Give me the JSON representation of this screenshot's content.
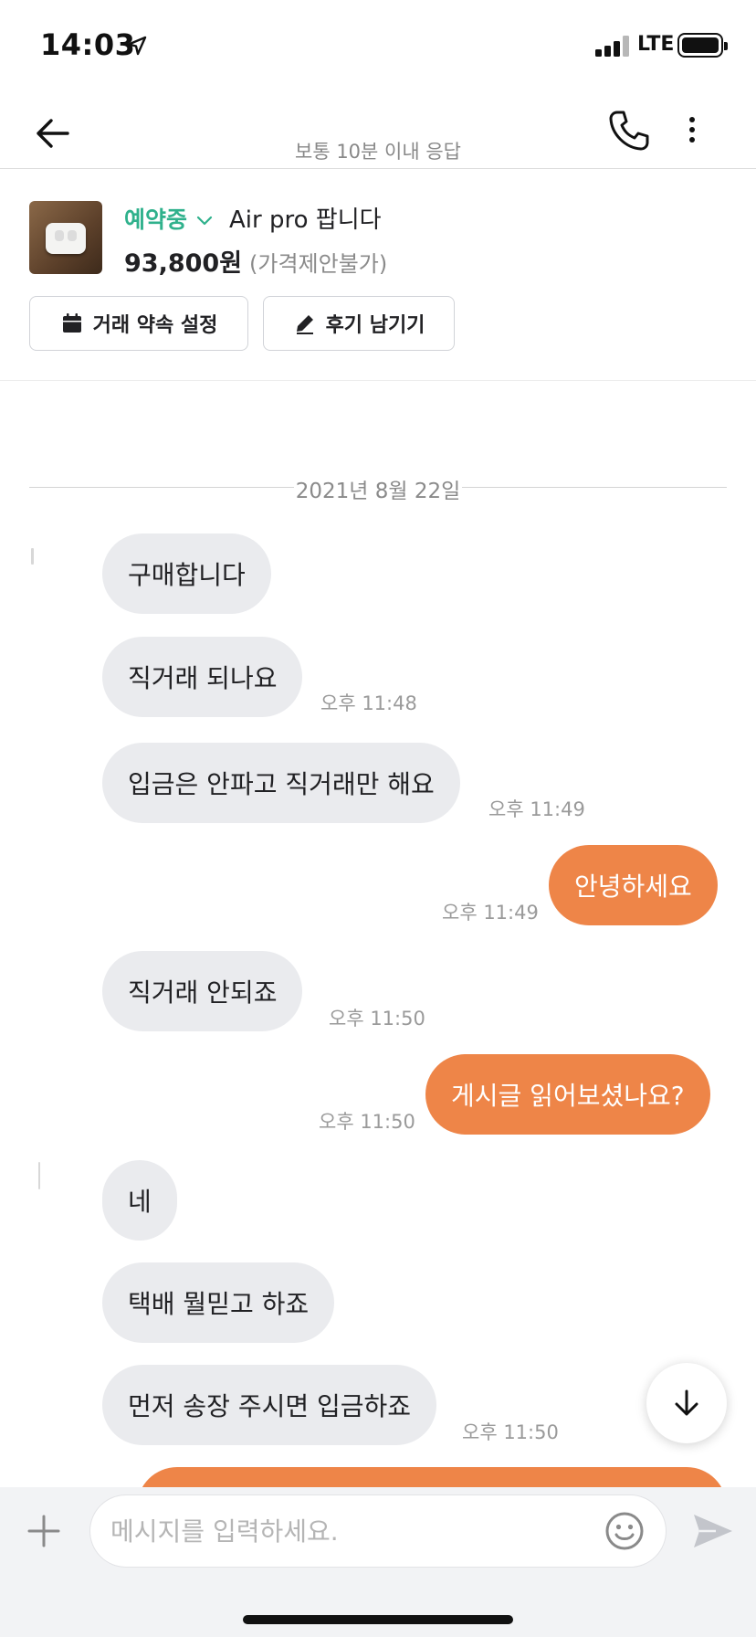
{
  "status_bar": {
    "time": "14:03",
    "network": "LTE"
  },
  "header": {
    "response_time": "보통 10분 이내 응답"
  },
  "product": {
    "status": "예약중",
    "title": "Air pro 팝니다",
    "price": "93,800원",
    "price_note": "(가격제안불가)",
    "buttons": {
      "schedule": "거래 약속 설정",
      "review": "후기 남기기"
    }
  },
  "chat": {
    "date": "2021년 8월 22일",
    "messages": [
      {
        "dir": "in",
        "text": "구매합니다",
        "time": ""
      },
      {
        "dir": "in",
        "text": "직거래 되나요",
        "time": "오후 11:48"
      },
      {
        "dir": "in",
        "text": "입금은 안파고 직거래만 해요",
        "time": "오후 11:49"
      },
      {
        "dir": "out",
        "text": "안녕하세요",
        "time": "오후 11:49"
      },
      {
        "dir": "in",
        "text": "직거래 안되죠",
        "time": "오후 11:50"
      },
      {
        "dir": "out",
        "text": "게시글 읽어보셨나요?",
        "time": "오후 11:50"
      },
      {
        "dir": "in",
        "text": "네",
        "time": ""
      },
      {
        "dir": "in",
        "text": "택배 뭘믿고 하죠",
        "time": ""
      },
      {
        "dir": "in",
        "text": "먼저 송장 주시면 입금하죠",
        "time": "오후 11:50"
      }
    ]
  },
  "composer": {
    "placeholder": "메시지를 입력하세요."
  },
  "colors": {
    "accent": "#ee8548",
    "reserved": "#2fb18c",
    "incoming_bubble": "#eaebee"
  }
}
